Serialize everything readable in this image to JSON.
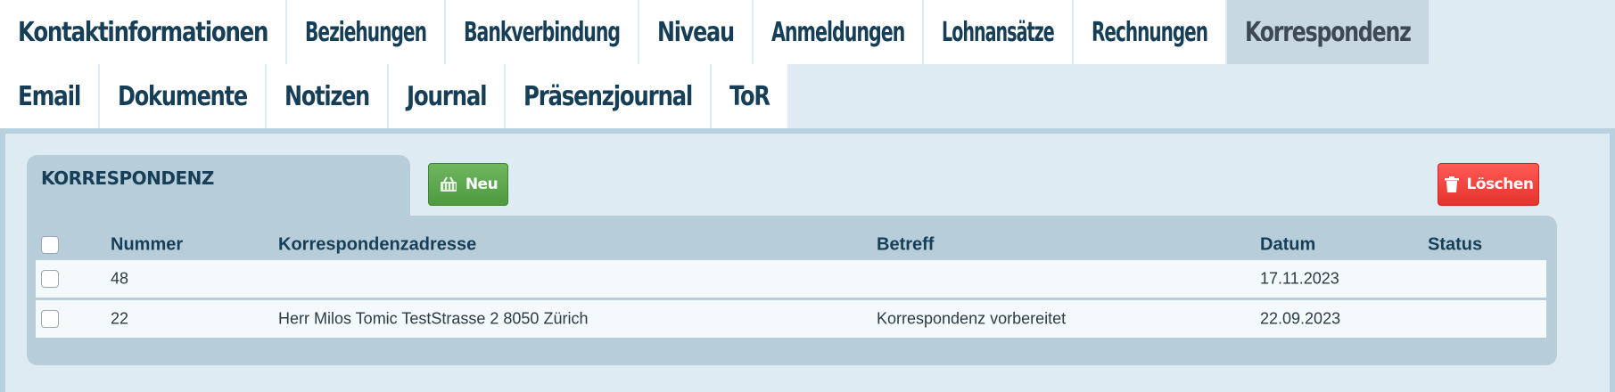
{
  "tabs": {
    "row1": [
      {
        "label": "Kontaktinformationen"
      },
      {
        "label": "Beziehungen"
      },
      {
        "label": "Bankverbindung"
      },
      {
        "label": "Niveau"
      },
      {
        "label": "Anmeldungen"
      },
      {
        "label": "Lohnansätze"
      },
      {
        "label": "Rechnungen"
      },
      {
        "label": "Korrespondenz",
        "active": true
      }
    ],
    "row2": [
      {
        "label": "Email"
      },
      {
        "label": "Dokumente"
      },
      {
        "label": "Notizen"
      },
      {
        "label": "Journal"
      },
      {
        "label": "Präsenzjournal"
      },
      {
        "label": "ToR"
      }
    ]
  },
  "section": {
    "title": "KORRESPONDENZ",
    "new_label": "Neu",
    "delete_label": "Löschen"
  },
  "table": {
    "headers": {
      "nummer": "Nummer",
      "adresse": "Korrespondenzadresse",
      "betreff": "Betreff",
      "datum": "Datum",
      "status": "Status"
    },
    "rows": [
      {
        "nummer": "48",
        "adresse": "",
        "betreff": "",
        "datum": "17.11.2023",
        "status": ""
      },
      {
        "nummer": "22",
        "adresse": "Herr Milos Tomic TestStrasse 2 8050 Zürich",
        "betreff": "Korrespondenz vorbereitet",
        "datum": "22.09.2023",
        "status": ""
      }
    ]
  },
  "colors": {
    "tab_text": "#173e57",
    "active_tab_bg": "#c7d8e3",
    "new_button": "#4e9a41",
    "delete_button": "#e8322e"
  },
  "icons": {
    "new": "basket-icon",
    "delete": "trash-icon"
  }
}
